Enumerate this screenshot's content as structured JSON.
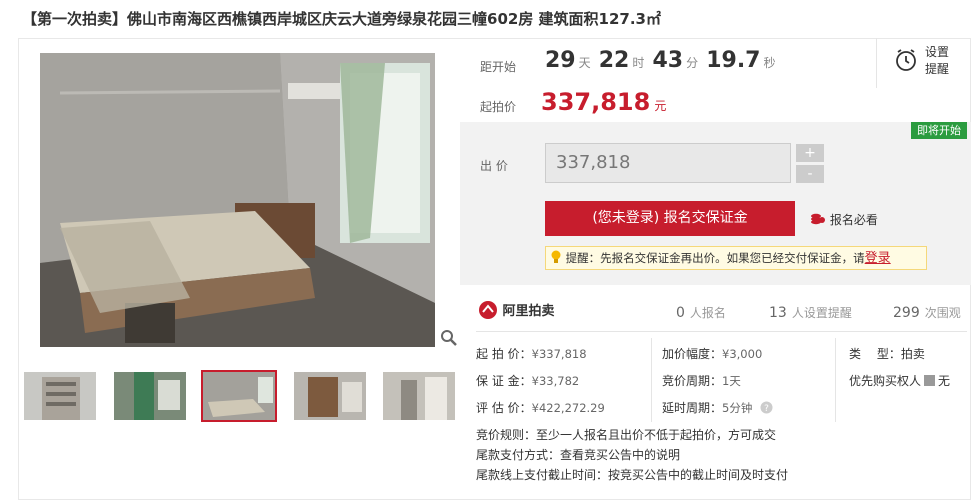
{
  "title": "【第一次拍卖】佛山市南海区西樵镇西岸城区庆云大道旁绿泉花园三幢602房 建筑面积127.3㎡",
  "countdown": {
    "label": "距开始",
    "days": "29",
    "days_unit": "天",
    "hours": "22",
    "hours_unit": "时",
    "minutes": "43",
    "minutes_unit": "分",
    "seconds": "19.7",
    "seconds_unit": "秒"
  },
  "start_price": {
    "label": "起拍价",
    "value": "337,818",
    "unit": "元"
  },
  "reminder": {
    "line1": "设置",
    "line2": "提醒"
  },
  "badge": "即将开始",
  "bid": {
    "label": "出 价",
    "value": "337,818",
    "plus": "+",
    "minus": "-"
  },
  "bond_button": "(您未登录) 报名交保证金",
  "must_read": "报名必看",
  "tip": {
    "prefix": "提醒：",
    "text": "先报名交保证金再出价。如果您已经交付保证金，请",
    "login": "登录"
  },
  "brand": "阿里拍卖",
  "stats": {
    "signup_count": "0",
    "signup_label": "人报名",
    "remind_count": "13",
    "remind_label": "人设置提醒",
    "view_count": "299",
    "view_label": "次围观"
  },
  "info": {
    "start_price_k": "起 拍 价：",
    "start_price_v": "¥337,818",
    "deposit_k": "保 证 金：",
    "deposit_v": "¥33,782",
    "appraisal_k": "评 估 价：",
    "appraisal_v": "¥422,272.29",
    "increment_k": "加价幅度：",
    "increment_v": "¥3,000",
    "cycle_k": "竞价周期：",
    "cycle_v": "1天",
    "extend_k": "延时周期：",
    "extend_v": "5分钟",
    "type_k": "类　 型：",
    "type_v": "拍卖",
    "priority_k": "优先购买权人",
    "priority_v": "无"
  },
  "rules": {
    "rule1_k": "竞价规则：",
    "rule1_v": "至少一人报名且出价不低于起拍价，方可成交",
    "rule2_k": "尾款支付方式：",
    "rule2_v": "查看竞买公告中的说明",
    "rule3_k": "尾款线上支付截止时间：",
    "rule3_v": "按竞买公告中的截止时间及时支付"
  },
  "colors": {
    "accent": "#c71d2d",
    "badge": "#2b9c3f"
  }
}
